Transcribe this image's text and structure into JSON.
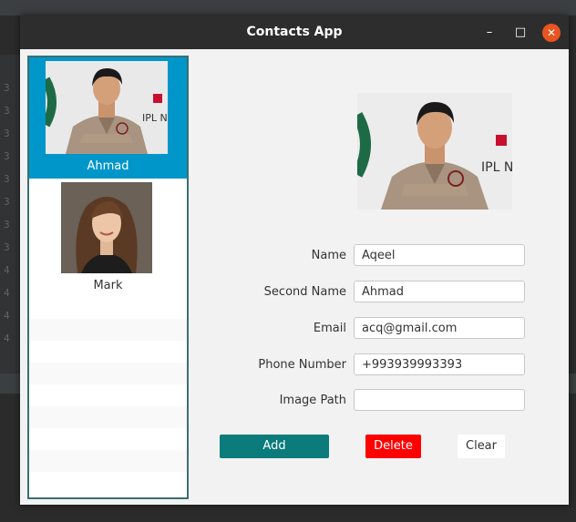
{
  "window": {
    "title": "Contacts App",
    "minimize_glyph": "–",
    "maximize_glyph": "□",
    "close_glyph": "✕",
    "close_color": "#e95420"
  },
  "contacts": [
    {
      "name": "Ahmad",
      "selected": true,
      "photo": "man-portrait"
    },
    {
      "name": "Mark",
      "selected": false,
      "photo": "woman-portrait"
    }
  ],
  "form": {
    "name_label": "Name",
    "name_value": "Aqeel",
    "second_name_label": "Second Name",
    "second_name_value": "Ahmad",
    "email_label": "Email",
    "email_value": "acq@gmail.com",
    "phone_label": "Phone Number",
    "phone_value": "+993939993393",
    "image_path_label": "Image Path",
    "image_path_value": ""
  },
  "buttons": {
    "add": "Add",
    "delete": "Delete",
    "clear": "Clear"
  },
  "colors": {
    "list_selection": "#0096c9",
    "add_button": "#0b7b7b",
    "delete_button": "#ff0000"
  }
}
